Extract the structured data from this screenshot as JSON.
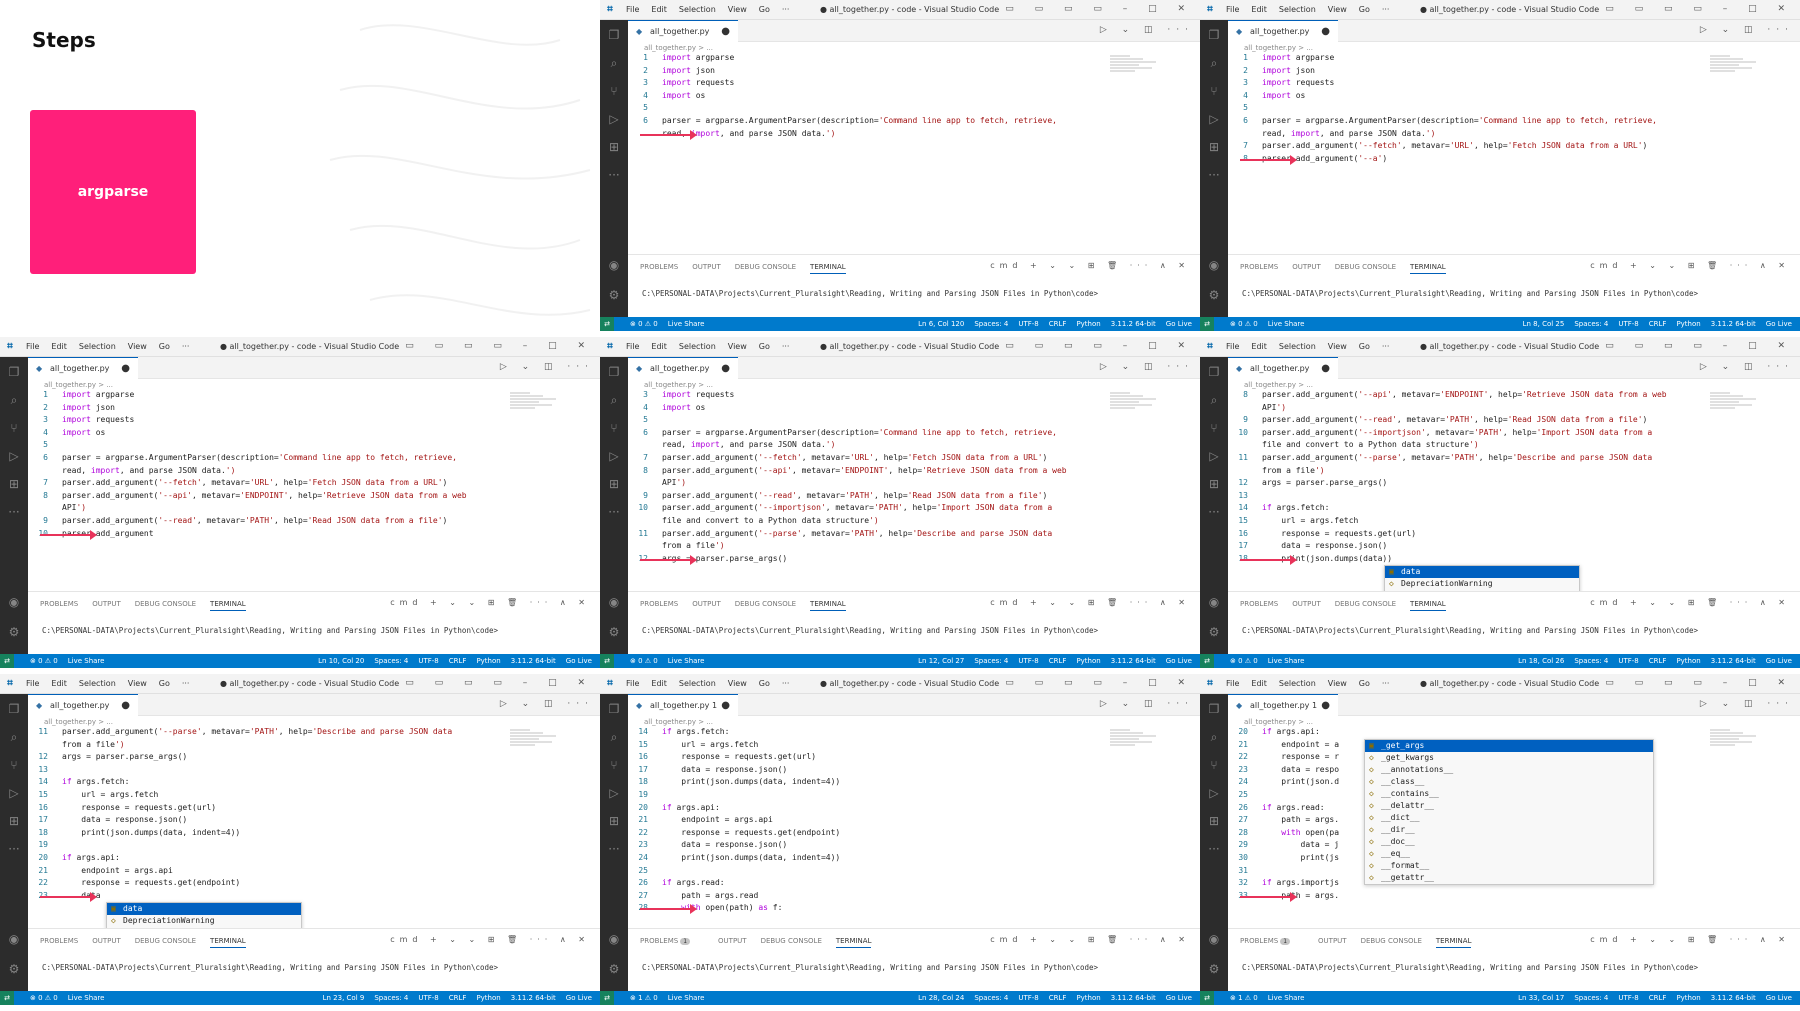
{
  "intro": {
    "title": "Steps",
    "step_label": "argparse"
  },
  "common": {
    "vs_icon": "⌗",
    "menus": [
      "File",
      "Edit",
      "Selection",
      "View",
      "Go",
      "···"
    ],
    "window_title": "● all_together.py - code - Visual Studio Code",
    "breadcrumb": "all_together.py > ...",
    "panel_tabs": [
      "PROBLEMS",
      "OUTPUT",
      "DEBUG CONSOLE",
      "TERMINAL"
    ],
    "panel_actions": "cmd + ⌄ ⌄ ⊞ 🗑 ··· ∧ ✕",
    "terminal_prompt": "C:\\PERSONAL-DATA\\Projects\\Current_Pluralsight\\Reading, Writing and Parsing JSON Files in Python\\code>",
    "status_left": [
      "⊗ 0 ⚠ 0",
      "Live Share"
    ],
    "status_right_fixed": [
      "Spaces: 4",
      "UTF-8",
      "CRLF",
      "Python",
      "3.11.2 64-bit",
      "Go Live"
    ],
    "colors": {
      "accent": "#ff1f7a",
      "statusbar": "#007acc",
      "arrow": "#e8335a"
    }
  },
  "panes": [
    {
      "tab": "all_together.py",
      "problems_count": "",
      "cursor": "Ln 6, Col 120",
      "status_problems": "⊗ 0 ⚠ 0",
      "lines": [
        [
          "1",
          "import argparse"
        ],
        [
          "2",
          "import json"
        ],
        [
          "3",
          "import requests"
        ],
        [
          "4",
          "import os"
        ],
        [
          "5",
          ""
        ],
        [
          "6",
          "parser = argparse.ArgumentParser(description='Command line app to fetch, retrieve,"
        ],
        [
          "",
          "read, import, and parse JSON data.')"
        ]
      ],
      "arrow_row": 6,
      "suggest": []
    },
    {
      "tab": "all_together.py",
      "problems_count": "",
      "cursor": "Ln 8, Col 25",
      "status_problems": "⊗ 0 ⚠ 0",
      "lines": [
        [
          "1",
          "import argparse"
        ],
        [
          "2",
          "import json"
        ],
        [
          "3",
          "import requests"
        ],
        [
          "4",
          "import os"
        ],
        [
          "5",
          ""
        ],
        [
          "6",
          "parser = argparse.ArgumentParser(description='Command line app to fetch, retrieve,"
        ],
        [
          "",
          "read, import, and parse JSON data.')"
        ],
        [
          "7",
          "parser.add_argument('--fetch', metavar='URL', help='Fetch JSON data from a URL')"
        ],
        [
          "8",
          "parser.add_argument('--a')"
        ]
      ],
      "arrow_row": 8,
      "suggest": []
    },
    {
      "tab": "all_together.py",
      "problems_count": "",
      "cursor": "Ln 10, Col 20",
      "status_problems": "⊗ 0 ⚠ 0",
      "lines": [
        [
          "1",
          "import argparse"
        ],
        [
          "2",
          "import json"
        ],
        [
          "3",
          "import requests"
        ],
        [
          "4",
          "import os"
        ],
        [
          "5",
          ""
        ],
        [
          "6",
          "parser = argparse.ArgumentParser(description='Command line app to fetch, retrieve,"
        ],
        [
          "",
          "read, import, and parse JSON data.')"
        ],
        [
          "7",
          "parser.add_argument('--fetch', metavar='URL', help='Fetch JSON data from a URL')"
        ],
        [
          "8",
          "parser.add_argument('--api', metavar='ENDPOINT', help='Retrieve JSON data from a web"
        ],
        [
          "",
          "API')"
        ],
        [
          "9",
          "parser.add_argument('--read', metavar='PATH', help='Read JSON data from a file')"
        ],
        [
          "10",
          "parser.add_argument"
        ]
      ],
      "arrow_row": 11,
      "suggest": []
    },
    {
      "tab": "all_together.py",
      "problems_count": "",
      "cursor": "Ln 12, Col 27",
      "status_problems": "⊗ 0 ⚠ 0",
      "lines": [
        [
          "3",
          "import requests"
        ],
        [
          "4",
          "import os"
        ],
        [
          "5",
          ""
        ],
        [
          "6",
          "parser = argparse.ArgumentParser(description='Command line app to fetch, retrieve,"
        ],
        [
          "",
          "read, import, and parse JSON data.')"
        ],
        [
          "7",
          "parser.add_argument('--fetch', metavar='URL', help='Fetch JSON data from a URL')"
        ],
        [
          "8",
          "parser.add_argument('--api', metavar='ENDPOINT', help='Retrieve JSON data from a web"
        ],
        [
          "",
          "API')"
        ],
        [
          "9",
          "parser.add_argument('--read', metavar='PATH', help='Read JSON data from a file')"
        ],
        [
          "10",
          "parser.add_argument('--importjson', metavar='PATH', help='Import JSON data from a"
        ],
        [
          "",
          "file and convert to a Python data structure')"
        ],
        [
          "11",
          "parser.add_argument('--parse', metavar='PATH', help='Describe and parse JSON data"
        ],
        [
          "",
          "from a file')"
        ],
        [
          "12",
          "args = parser.parse_args()"
        ]
      ],
      "arrow_row": 13,
      "suggest": []
    },
    {
      "tab": "all_together.py",
      "problems_count": "",
      "cursor": "Ln 18, Col 26",
      "status_problems": "⊗ 0 ⚠ 0",
      "lines": [
        [
          "8",
          "parser.add_argument('--api', metavar='ENDPOINT', help='Retrieve JSON data from a web"
        ],
        [
          "",
          "API')"
        ],
        [
          "9",
          "parser.add_argument('--read', metavar='PATH', help='Read JSON data from a file')"
        ],
        [
          "10",
          "parser.add_argument('--importjson', metavar='PATH', help='Import JSON data from a"
        ],
        [
          "",
          "file and convert to a Python data structure')"
        ],
        [
          "11",
          "parser.add_argument('--parse', metavar='PATH', help='Describe and parse JSON data"
        ],
        [
          "",
          "from a file')"
        ],
        [
          "12",
          "args = parser.parse_args()"
        ],
        [
          "13",
          ""
        ],
        [
          "14",
          "if args.fetch:"
        ],
        [
          "15",
          "    url = args.fetch"
        ],
        [
          "16",
          "    response = requests.get(url)"
        ],
        [
          "17",
          "    data = response.json()"
        ],
        [
          "18",
          "    print(json.dumps(data))"
        ]
      ],
      "arrow_row": 13,
      "suggest": [
        "data",
        "DepreciationWarning",
        "PendingDepreciationWarning"
      ],
      "suggest_row": 14
    },
    {
      "tab": "all_together.py",
      "problems_count": "",
      "cursor": "Ln 23, Col 9",
      "status_problems": "⊗ 0 ⚠ 0",
      "lines": [
        [
          "11",
          "parser.add_argument('--parse', metavar='PATH', help='Describe and parse JSON data"
        ],
        [
          "",
          "from a file')"
        ],
        [
          "12",
          "args = parser.parse_args()"
        ],
        [
          "13",
          ""
        ],
        [
          "14",
          "if args.fetch:"
        ],
        [
          "15",
          "    url = args.fetch"
        ],
        [
          "16",
          "    response = requests.get(url)"
        ],
        [
          "17",
          "    data = response.json()"
        ],
        [
          "18",
          "    print(json.dumps(data, indent=4))"
        ],
        [
          "19",
          ""
        ],
        [
          "20",
          "if args.api:"
        ],
        [
          "21",
          "    endpoint = args.api"
        ],
        [
          "22",
          "    response = requests.get(endpoint)"
        ],
        [
          "23",
          "    data"
        ]
      ],
      "arrow_row": 13,
      "suggest": [
        "data",
        "DepreciationWarning",
        "PendingDepreciationWarning"
      ],
      "suggest_row": 14
    },
    {
      "tab": "all_together.py 1",
      "problems_count": "1",
      "cursor": "Ln 28, Col 24",
      "status_problems": "⊗ 1 ⚠ 0",
      "lines": [
        [
          "14",
          "if args.fetch:"
        ],
        [
          "15",
          "    url = args.fetch"
        ],
        [
          "16",
          "    response = requests.get(url)"
        ],
        [
          "17",
          "    data = response.json()"
        ],
        [
          "18",
          "    print(json.dumps(data, indent=4))"
        ],
        [
          "19",
          ""
        ],
        [
          "20",
          "if args.api:"
        ],
        [
          "21",
          "    endpoint = args.api"
        ],
        [
          "22",
          "    response = requests.get(endpoint)"
        ],
        [
          "23",
          "    data = response.json()"
        ],
        [
          "24",
          "    print(json.dumps(data, indent=4))"
        ],
        [
          "25",
          ""
        ],
        [
          "26",
          "if args.read:"
        ],
        [
          "27",
          "    path = args.read"
        ],
        [
          "28",
          "    with open(path) as f:"
        ]
      ],
      "arrow_row": 14,
      "suggest": []
    },
    {
      "tab": "all_together.py 1",
      "problems_count": "1",
      "cursor": "Ln 33, Col 17",
      "status_problems": "⊗ 1 ⚠ 0",
      "lines": [
        [
          "20",
          "if args.api:"
        ],
        [
          "21",
          "    endpoint = a"
        ],
        [
          "22",
          "    response = r"
        ],
        [
          "23",
          "    data = respo"
        ],
        [
          "24",
          "    print(json.d"
        ],
        [
          "25",
          ""
        ],
        [
          "26",
          "if args.read:"
        ],
        [
          "27",
          "    path = args."
        ],
        [
          "28",
          "    with open(pa"
        ],
        [
          "29",
          "        data = j"
        ],
        [
          "30",
          "        print(js"
        ],
        [
          "31",
          ""
        ],
        [
          "32",
          "if args.importjs"
        ],
        [
          "33",
          "    path = args."
        ]
      ],
      "arrow_row": 13,
      "suggest": [
        "_get_args",
        "_get_kwargs",
        "__annotations__",
        "__class__",
        "__contains__",
        "__delattr__",
        "__dict__",
        "__dir__",
        "__doc__",
        "__eq__",
        "__format__",
        "__getattr__"
      ],
      "suggest_row": 1
    }
  ]
}
